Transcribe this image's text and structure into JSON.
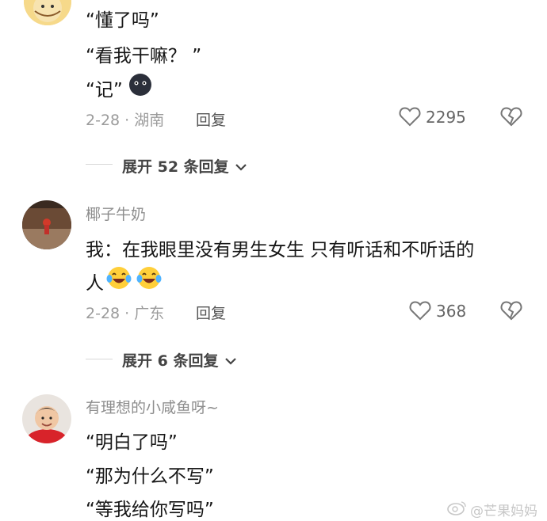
{
  "comments": [
    {
      "lines": [
        "“懂了吗”",
        "“看我干嘛？ ”",
        "“记”"
      ],
      "meta": "2-28 · 湖南",
      "reply": "回复",
      "likes": "2295",
      "expand": "展开 52 条回复"
    },
    {
      "username": "椰子牛奶",
      "lines": [
        "我：在我眼里没有男生女生 只有听话和不听话的",
        "人"
      ],
      "meta": "2-28 · 广东",
      "reply": "回复",
      "likes": "368",
      "expand": "展开 6 条回复"
    },
    {
      "username": "有理想的小咸鱼呀~",
      "lines": [
        "“明白了吗”",
        "“那为什么不写”",
        "“等我给你写吗”"
      ]
    }
  ],
  "watermark": "@芒果妈妈",
  "icons": {
    "like": "heart-outline-icon",
    "dislike": "broken-heart-icon",
    "expand": "chevron-down-icon",
    "emoji_blob": "dark-blob-emoji",
    "emoji_laugh": "laughing-crying-emoji"
  }
}
